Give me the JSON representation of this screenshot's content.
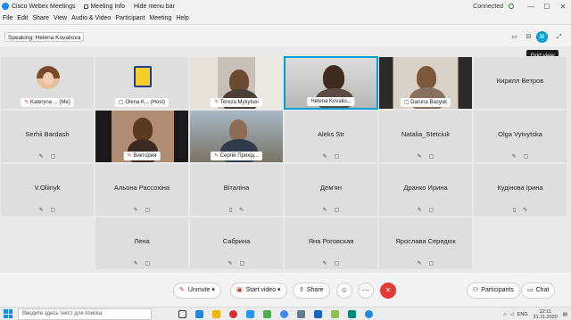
{
  "titlebar": {
    "app_title": "Cisco Webex Meetings",
    "meeting_info": "Meeting Info",
    "hide_menu": "Hide menu bar",
    "status": "Connected",
    "min": "—",
    "max": "☐",
    "close": "✕"
  },
  "menu": [
    "File",
    "Edit",
    "Share",
    "View",
    "Audio & Video",
    "Participant",
    "Meeting",
    "Help"
  ],
  "speaking": {
    "label": "Speaking:",
    "name": "Helena Kovaliova"
  },
  "tooltip": "Grid view",
  "tiles": [
    {
      "name": "Kateryna ...",
      "suffix": "(Me)",
      "type": "avatar"
    },
    {
      "name": "Olena K...",
      "suffix": "(Host)",
      "type": "emblem"
    },
    {
      "name": "Tereza Mykytsei",
      "type": "video"
    },
    {
      "name": "Helena Kovalio...",
      "type": "video",
      "active": true
    },
    {
      "name": "Daruna Basyuk",
      "type": "video"
    },
    {
      "name": "Кирилл Ветров",
      "type": "name"
    },
    {
      "name": "Serhii Bardash",
      "type": "name"
    },
    {
      "name": "Виктория",
      "type": "video"
    },
    {
      "name": "Сергій Прихід...",
      "type": "video"
    },
    {
      "name": "Aleks Str",
      "type": "name"
    },
    {
      "name": "Natalia_Stetciuk",
      "type": "name"
    },
    {
      "name": "Olga Vytvytska",
      "type": "name"
    },
    {
      "name": "V.Oliinyk",
      "type": "name"
    },
    {
      "name": "Альона Рассохіна",
      "type": "name"
    },
    {
      "name": "Віталіна",
      "type": "name"
    },
    {
      "name": "Дем'ян",
      "type": "name"
    },
    {
      "name": "Дранко Ирина",
      "type": "name"
    },
    {
      "name": "Кудінова Ірина",
      "type": "name"
    },
    {
      "name": "Лена",
      "type": "name"
    },
    {
      "name": "Сабрина",
      "type": "name"
    },
    {
      "name": "Яна Роговская",
      "type": "name"
    },
    {
      "name": "Ярослава Середюк",
      "type": "name"
    }
  ],
  "controls": {
    "unmute": "Unmute",
    "start_video": "Start video",
    "share": "Share",
    "participants": "Participants",
    "chat": "Chat"
  },
  "taskbar": {
    "search_placeholder": "Введите здесь текст для поиска",
    "lang": "ENG",
    "time": "12:11",
    "date": "21.11.2020"
  },
  "colors": {
    "accent": "#00a0d1",
    "end_call": "#e53935",
    "mute_icon": "#d32f2f"
  }
}
